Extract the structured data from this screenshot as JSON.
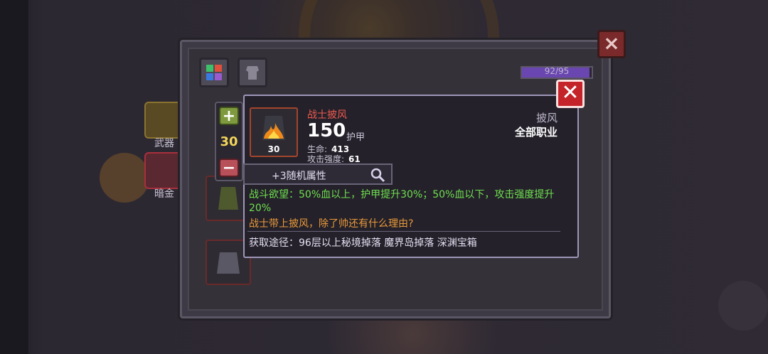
{
  "background": {
    "side_tabs": [
      {
        "label": "武器",
        "color": "#c39a3a"
      },
      {
        "label": "暗金",
        "color": "#c03a48"
      }
    ]
  },
  "inventory": {
    "capacity": "92/95",
    "capacity_fraction": 0.968
  },
  "stepper": {
    "plus": "+",
    "minus": "−",
    "value": "30"
  },
  "item": {
    "name": "战士披风",
    "level": "30",
    "power": "150",
    "power_unit": "护甲",
    "stats": [
      {
        "label": "生命:",
        "value": "413"
      },
      {
        "label": "攻击强度:",
        "value": "61"
      }
    ],
    "type": "披风",
    "class": "全部职业",
    "random_attr": "+3随机属性",
    "effect": "战斗欲望：50%血以上，护甲提升30%；50%血以下，攻击强度提升20%",
    "flavor": "战士带上披风，除了帅还有什么理由?",
    "source": "获取途径：96层以上秘境掉落 魔界岛掉落 深渊宝箱"
  },
  "colors": {
    "name_red": "#ef5a4e",
    "effect_green": "#6fe04f",
    "flavor_orange": "#ea9a3a",
    "close_red": "#c4232a"
  },
  "icons": {
    "close": "close-icon",
    "magnifier": "magnifier-icon",
    "item": "flame-cape-icon"
  }
}
